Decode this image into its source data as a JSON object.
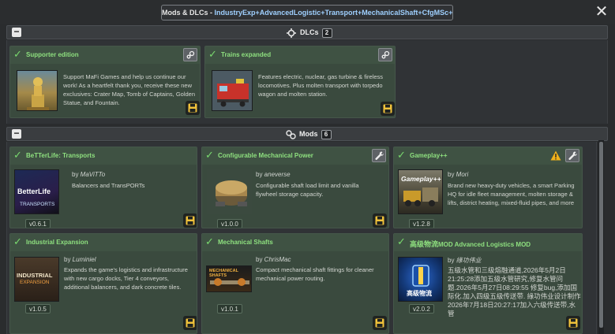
{
  "window": {
    "title_prefix": "Mods & DLCs - ",
    "title_mods": "IndustryExp+AdvancedLogistic+Transport+MechanicalShaft+CfgMSc+Gameplay++",
    "close_glyph": "✕"
  },
  "dlcs": {
    "label": "DLCs",
    "count": "2",
    "collapse_glyph": "−",
    "items": [
      {
        "title": "Supporter edition",
        "description": "Support MaFi Games and help us continue our work! As a heartfelt thank you, receive these new exclusives: Crater Map, Tomb of Captains, Golden Statue, and Fountain."
      },
      {
        "title": "Trains expanded",
        "description": "Features electric, nuclear, gas turbine & fireless locomotives. Plus molten transport with torpedo wagon and molten station."
      }
    ]
  },
  "mods": {
    "label": "Mods",
    "count": "6",
    "collapse_glyph": "−",
    "items": [
      {
        "title": "BeTTerLife: Transports",
        "by": "by ",
        "author": "MaViTTo",
        "description": "Balancers and TransPORTs",
        "version": "v0.6.1",
        "thumb_text": "BetterLife",
        "thumb_sub": "TRANSPORTS"
      },
      {
        "title": "Configurable Mechanical Power",
        "by": "by ",
        "author": "aneverse",
        "description": "Configurable shaft load limit and vanilla flywheel storage capacity.",
        "version": "v1.0.0"
      },
      {
        "title": "Gameplay++",
        "by": "by ",
        "author": "Mori",
        "description": "Brand new heavy-duty vehicles, a smart Parking HQ for idle fleet management, molten storage & lifts, district heating, mixed-fluid pipes, and more",
        "version": "v1.2.8",
        "thumb_text": "Gameplay++"
      },
      {
        "title": "Industrial Expansion",
        "by": "by ",
        "author": "Luminiel",
        "description": "Expands the game's logistics and infrastructure with new cargo docks, Tier 4 conveyors, additional balancers, and dark concrete tiles.",
        "version": "v1.0.5",
        "thumb_text": "INDUSTRIAL",
        "thumb_sub": "EXPANSION"
      },
      {
        "title": "Mechanical Shafts",
        "by": "by ",
        "author": "ChrisMac",
        "description": "Compact mechanical shaft fittings for cleaner mechanical power routing.",
        "version": "v1.0.1",
        "thumb_text": "MECHANICAL SHAFTS"
      },
      {
        "title_cn": "高级物流",
        "title": "MOD Advanced Logistics MOD",
        "by": "by ",
        "author": "綠功伟业",
        "description": "五级水管和三级熔融通道,2026年5月2日21:25:28添加五级水管研究,修复水管问题.2026年5月27日08:29:55 修复bug,添加国际化.加入四级五级传送带. 綠功伟业设计制作 2026年7月18日20:27:17加入六级传送带,水管",
        "version": "v2.0.2",
        "thumb_text": "高级物流"
      }
    ]
  },
  "colors": {
    "enabled_green": "#79d96e",
    "card_bg": "#3a4a3e",
    "warning": "#f2b21a",
    "save_icon": "#f0c23a"
  },
  "icons": [
    "close-icon",
    "gear-icon",
    "puzzle-icon",
    "checkmark-icon",
    "settings-icon",
    "wrench-icon",
    "warning-icon",
    "save-icon",
    "collapse-icon"
  ]
}
